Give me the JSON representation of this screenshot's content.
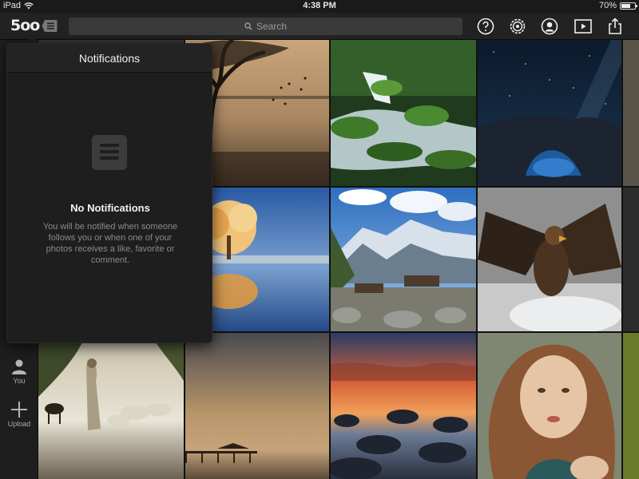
{
  "status_bar": {
    "device": "iPad",
    "time": "4:38 PM",
    "battery": "70%",
    "battery_level": 0.7
  },
  "navbar": {
    "logo": "5oo",
    "search_placeholder": "Search",
    "icons": [
      "help-icon",
      "settings-icon",
      "profile-icon",
      "slideshow-icon",
      "share-icon"
    ]
  },
  "sidebar": {
    "items": [
      {
        "label": "You",
        "icon": "user-icon"
      },
      {
        "label": "Upload",
        "icon": "plus-icon"
      }
    ]
  },
  "notifications": {
    "title": "Notifications",
    "empty_title": "No Notifications",
    "empty_message": "You will be notified when someone follows you or when one of your photos receives a like, favorite or comment."
  },
  "photos": [
    {
      "subject": "tree-lake-birds"
    },
    {
      "subject": "forest-waterfall"
    },
    {
      "subject": "milky-way-cave"
    },
    {
      "subject": "golden-tree-reflection"
    },
    {
      "subject": "mountains-horses"
    },
    {
      "subject": "eagle"
    },
    {
      "subject": "shepherd-goats"
    },
    {
      "subject": "pier-sunset"
    },
    {
      "subject": "rocky-shore-sunset"
    },
    {
      "subject": "woman-portrait"
    }
  ],
  "colors": {
    "background": "#111111",
    "panel": "#1e1e1e",
    "accent_text": "#f0f0f0"
  }
}
